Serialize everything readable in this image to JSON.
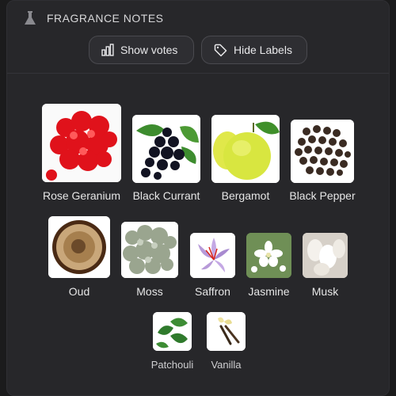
{
  "section": {
    "title": "FRAGRANCE NOTES",
    "icon": "flask-icon"
  },
  "buttons": {
    "show_votes": "Show votes",
    "hide_labels": "Hide Labels"
  },
  "notes": [
    {
      "name": "Rose Geranium",
      "icon": "rose-geranium-icon"
    },
    {
      "name": "Black Currant",
      "icon": "black-currant-icon"
    },
    {
      "name": "Bergamot",
      "icon": "bergamot-icon"
    },
    {
      "name": "Black Pepper",
      "icon": "black-pepper-icon"
    },
    {
      "name": "Oud",
      "icon": "oud-icon"
    },
    {
      "name": "Moss",
      "icon": "moss-icon"
    },
    {
      "name": "Saffron",
      "icon": "saffron-icon"
    },
    {
      "name": "Jasmine",
      "icon": "jasmine-icon"
    },
    {
      "name": "Musk",
      "icon": "musk-icon"
    },
    {
      "name": "Patchouli",
      "icon": "patchouli-icon"
    },
    {
      "name": "Vanilla",
      "icon": "vanilla-icon"
    }
  ],
  "colors": {
    "background": "#1b1b1c",
    "card": "#27272a",
    "button_border": "#4a4a4f",
    "text": "#e6e6e6"
  }
}
